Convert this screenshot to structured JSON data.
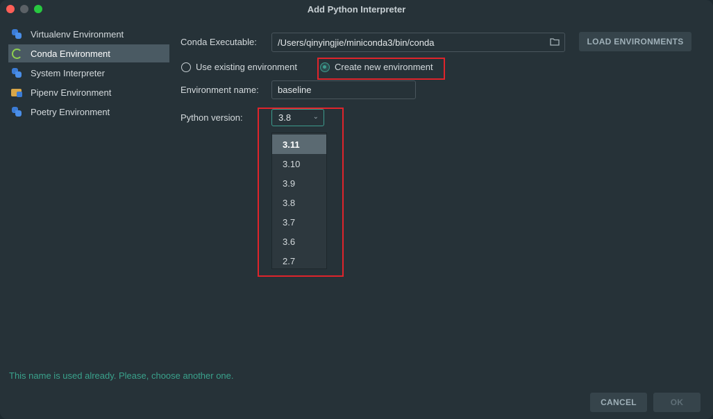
{
  "window": {
    "title": "Add Python Interpreter"
  },
  "sidebar": {
    "items": [
      {
        "label": "Virtualenv Environment",
        "icon": "python-icon",
        "selected": false
      },
      {
        "label": "Conda Environment",
        "icon": "conda-icon",
        "selected": true
      },
      {
        "label": "System Interpreter",
        "icon": "python-icon",
        "selected": false
      },
      {
        "label": "Pipenv Environment",
        "icon": "pipenv-folder-icon",
        "selected": false
      },
      {
        "label": "Poetry Environment",
        "icon": "python-icon",
        "selected": false
      }
    ]
  },
  "form": {
    "conda_executable_label": "Conda Executable:",
    "conda_executable_value": "/Users/qinyingjie/miniconda3/bin/conda",
    "load_environments_label": "LOAD ENVIRONMENTS",
    "use_existing_label": "Use existing environment",
    "create_new_label": "Create new environment",
    "selected_mode": "Create new environment",
    "env_name_label": "Environment name:",
    "env_name_value": "baseline",
    "python_version_label": "Python version:",
    "python_version_value": "3.8",
    "python_version_options": [
      "3.11",
      "3.10",
      "3.9",
      "3.8",
      "3.7",
      "3.6",
      "2.7"
    ],
    "highlighted_option": "3.11"
  },
  "status": {
    "error_text": "This name is used already. Please, choose another one."
  },
  "footer": {
    "cancel_label": "CANCEL",
    "ok_label": "OK"
  },
  "colors": {
    "accent": "#3d9d8e",
    "annotation_red": "#e0242b",
    "error_text": "#3aa28c"
  }
}
